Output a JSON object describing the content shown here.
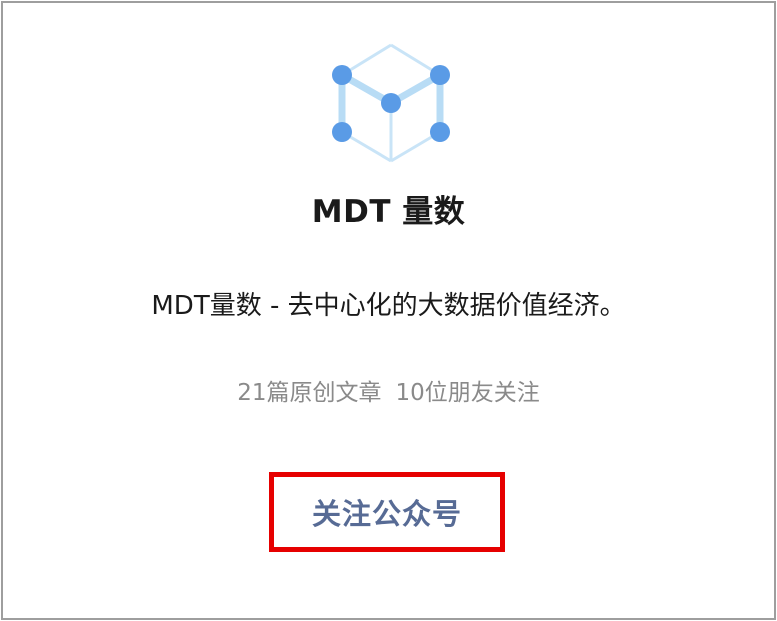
{
  "account": {
    "logo_icon": "mdt-cube-icon",
    "name": "MDT 量数",
    "description": "MDT量数 - 去中心化的大数据价值经济。",
    "articles": "21篇原创文章",
    "followers": "10位朋友关注"
  },
  "actions": {
    "follow_label": "关注公众号"
  },
  "colors": {
    "link_blue": "#576b95",
    "highlight_red": "#e60000",
    "logo_node": "#4a90e2",
    "logo_edge": "#b8dcf5"
  }
}
